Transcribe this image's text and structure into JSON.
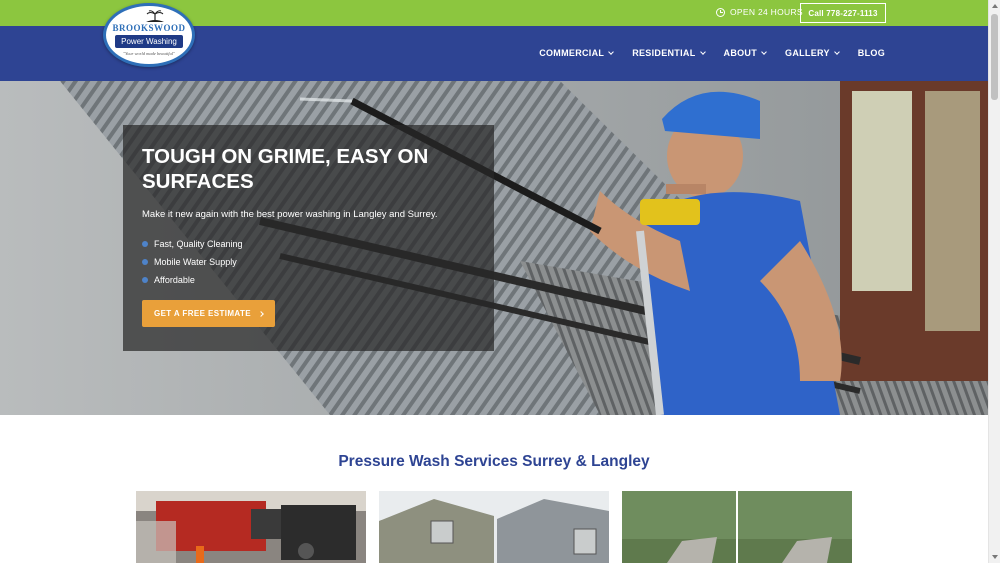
{
  "topbar": {
    "hours": "OPEN 24 HOURS",
    "call": "Call 778-227-1113",
    "colors": {
      "green": "#8cc63f"
    }
  },
  "logo": {
    "brand": "BROOKSWOOD",
    "banner": "Power Washing",
    "tagline": "\"Your world made beautiful\""
  },
  "nav": {
    "items": [
      {
        "label": "COMMERCIAL",
        "dropdown": true
      },
      {
        "label": "RESIDENTIAL",
        "dropdown": true
      },
      {
        "label": "ABOUT",
        "dropdown": true
      },
      {
        "label": "GALLERY",
        "dropdown": true
      },
      {
        "label": "BLOG",
        "dropdown": false
      }
    ],
    "color": "#2e4493"
  },
  "hero": {
    "title": "TOUGH ON GRIME, EASY ON SURFACES",
    "subtitle": "Make it new again with the best power washing in Langley and Surrey.",
    "bullets": [
      "Fast, Quality Cleaning",
      "Mobile Water Supply",
      "Affordable"
    ],
    "cta": "GET A FREE ESTIMATE",
    "accent": "#e9a03a"
  },
  "services": {
    "title": "Pressure Wash Services Surrey & Langley",
    "cards": [
      {
        "icon": "truck-cleaning-photo"
      },
      {
        "icon": "house-siding-photo"
      },
      {
        "icon": "driveway-photo"
      }
    ]
  }
}
